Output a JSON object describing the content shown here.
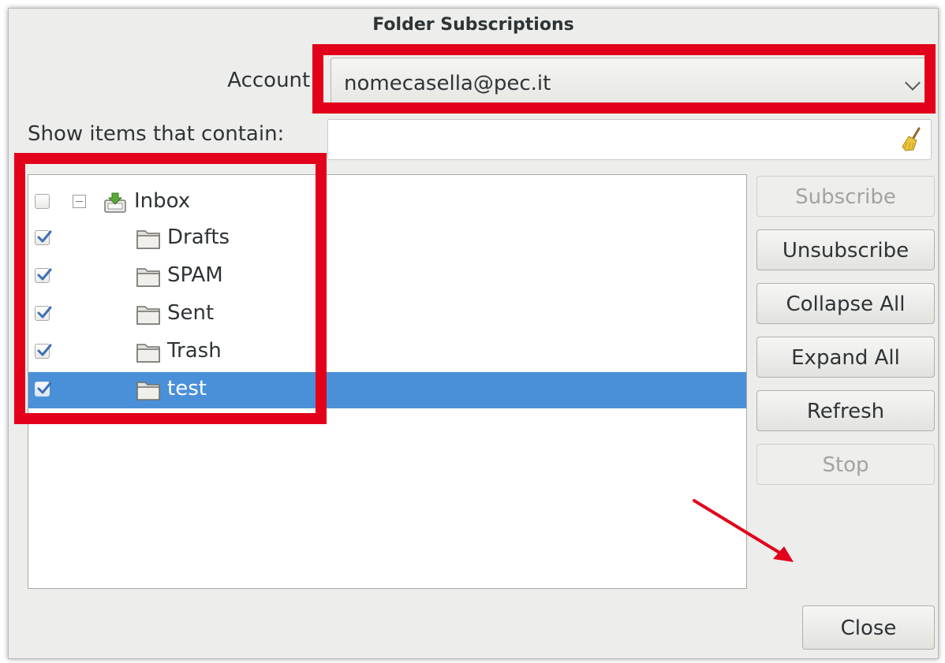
{
  "dialog": {
    "title": "Folder Subscriptions"
  },
  "account": {
    "label": "Account:",
    "selected": "nomecasella@pec.it"
  },
  "filter": {
    "label": "Show items that contain:",
    "value": "",
    "clear_icon": "broom-icon"
  },
  "tree": {
    "rows": [
      {
        "name": "Inbox",
        "checked": false,
        "expanded": true,
        "icon": "inbox-icon"
      },
      {
        "name": "Drafts",
        "checked": true,
        "icon": "folder-icon"
      },
      {
        "name": "SPAM",
        "checked": true,
        "icon": "folder-icon"
      },
      {
        "name": "Sent",
        "checked": true,
        "icon": "folder-icon"
      },
      {
        "name": "Trash",
        "checked": true,
        "icon": "folder-icon"
      },
      {
        "name": "test",
        "checked": true,
        "icon": "folder-icon",
        "selected": true
      }
    ]
  },
  "buttons": {
    "subscribe": "Subscribe",
    "unsubscribe": "Unsubscribe",
    "collapse_all": "Collapse All",
    "expand_all": "Expand All",
    "refresh": "Refresh",
    "stop": "Stop",
    "close": "Close"
  },
  "colors": {
    "selection": "#4a90d9",
    "annotation": "#e3001b",
    "dialog_bg": "#ededeb"
  }
}
